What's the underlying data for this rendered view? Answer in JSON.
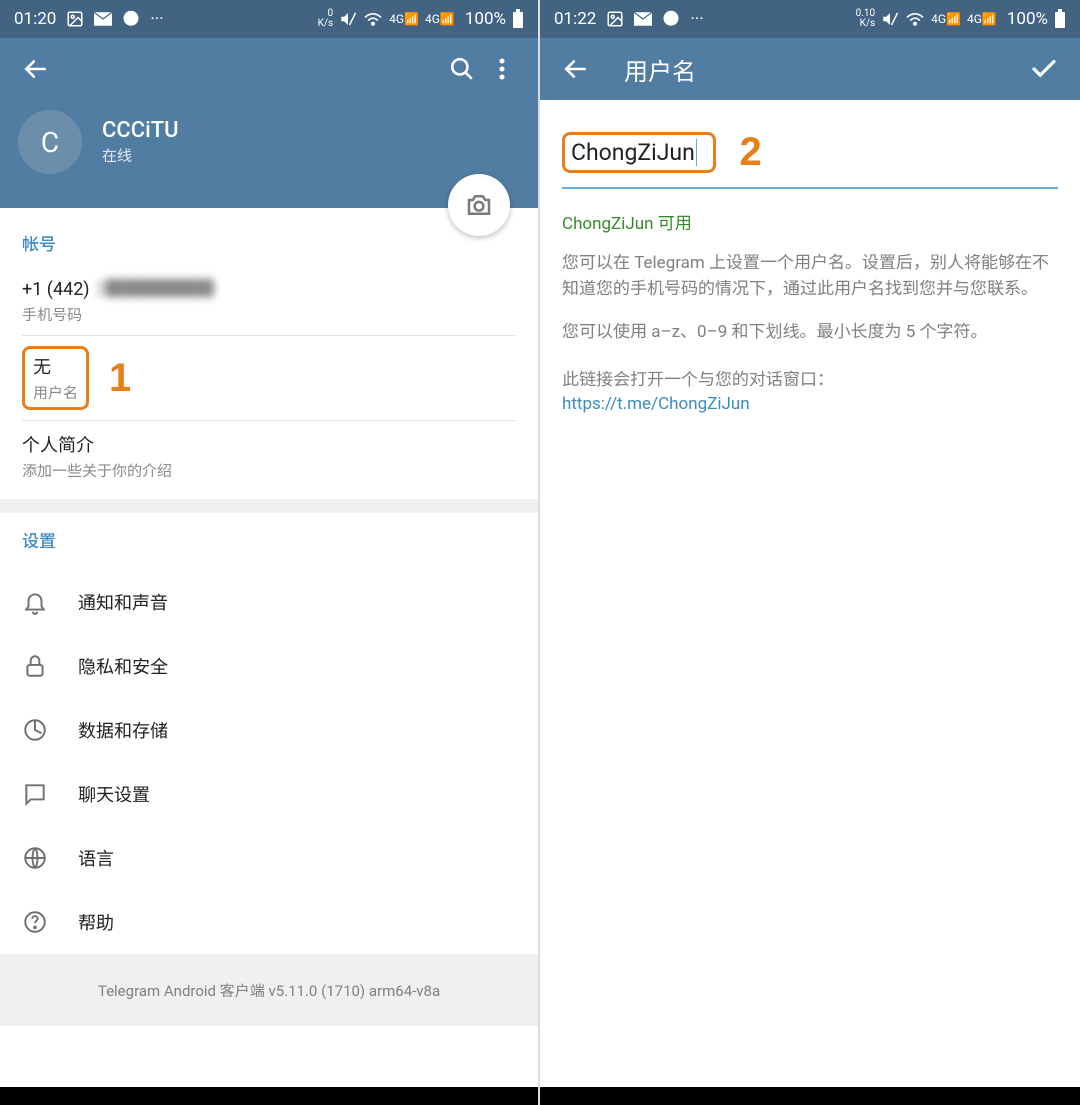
{
  "left": {
    "status": {
      "time": "01:20",
      "speed_top": "0",
      "speed_unit": "K/s",
      "net": "4G",
      "battery": "100%"
    },
    "profile": {
      "initial": "C",
      "name": "CCCiTU",
      "status": "在线"
    },
    "account": {
      "header": "帐号",
      "phone_prefix": "+1 (442)",
      "phone_rest": "2██████",
      "phone_label": "手机号码",
      "username_value": "无",
      "username_label": "用户名",
      "bio_title": "个人简介",
      "bio_hint": "添加一些关于你的介绍"
    },
    "settings": {
      "header": "设置",
      "items": [
        {
          "key": "notifications",
          "label": "通知和声音"
        },
        {
          "key": "privacy",
          "label": "隐私和安全"
        },
        {
          "key": "data",
          "label": "数据和存储"
        },
        {
          "key": "chat",
          "label": "聊天设置"
        },
        {
          "key": "language",
          "label": "语言"
        },
        {
          "key": "help",
          "label": "帮助"
        }
      ]
    },
    "footer": "Telegram Android 客户端 v5.11.0 (1710) arm64-v8a",
    "annot": "1"
  },
  "right": {
    "status": {
      "time": "01:22",
      "speed_top": "0.10",
      "speed_unit": "K/s",
      "net": "4G",
      "battery": "100%"
    },
    "title": "用户名",
    "input_value": "ChongZiJun",
    "annot": "2",
    "available": "ChongZiJun 可用",
    "help1": "您可以在 Telegram 上设置一个用户名。设置后，别人将能够在不知道您的手机号码的情况下，通过此用户名找到您并与您联系。",
    "help2": "您可以使用 a–z、0–9 和下划线。最小长度为 5 个字符。",
    "link_intro": "此链接会打开一个与您的对话窗口：",
    "link_url": "https://t.me/ChongZiJun"
  }
}
